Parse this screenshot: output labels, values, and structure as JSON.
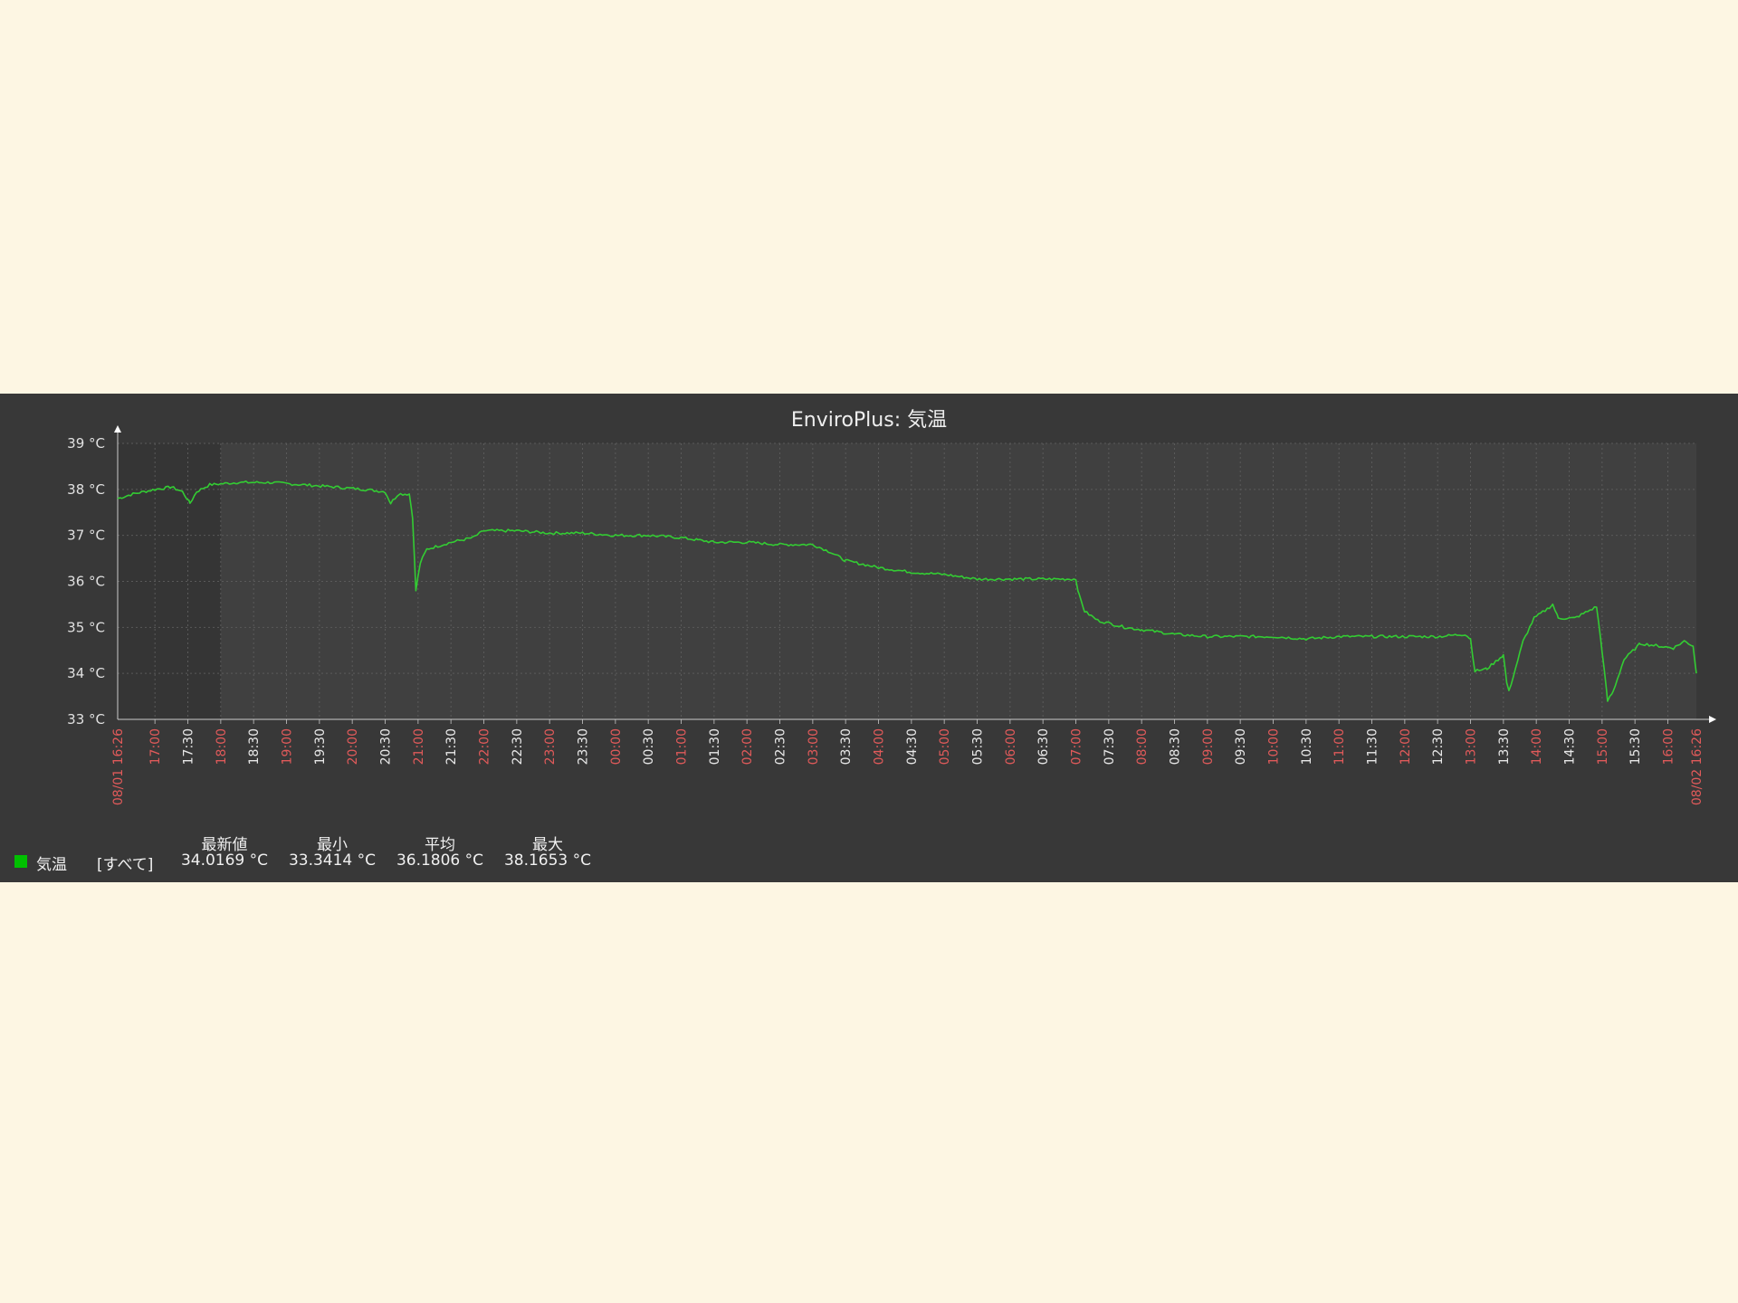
{
  "chart_data": {
    "type": "line",
    "title": "EnviroPlus: 気温",
    "y_ticks": [
      "33 °C",
      "34 °C",
      "35 °C",
      "36 °C",
      "37 °C",
      "38 °C",
      "39 °C"
    ],
    "ylim": [
      33,
      39
    ],
    "x_start_label": "08/01 16:26",
    "x_end_label": "08/02 16:26",
    "x_ticks": [
      "17:00",
      "17:30",
      "18:00",
      "18:30",
      "19:00",
      "19:30",
      "20:00",
      "20:30",
      "21:00",
      "21:30",
      "22:00",
      "22:30",
      "23:00",
      "23:30",
      "00:00",
      "00:30",
      "01:00",
      "01:30",
      "02:00",
      "02:30",
      "03:00",
      "03:30",
      "04:00",
      "04:30",
      "05:00",
      "05:30",
      "06:00",
      "06:30",
      "07:00",
      "07:30",
      "08:00",
      "08:30",
      "09:00",
      "09:30",
      "10:00",
      "10:30",
      "11:00",
      "11:30",
      "12:00",
      "12:30",
      "13:00",
      "13:30",
      "14:00",
      "14:30",
      "15:00",
      "15:30",
      "16:00"
    ],
    "x_range": [
      "08/01 16:26",
      "08/02 16:26"
    ],
    "grid": true,
    "colors": {
      "series": "#33cc33",
      "hour_tick": "#e05a5a",
      "half_tick": "#e8e8e8"
    },
    "series": [
      {
        "name": "気温",
        "color": "#00c000",
        "points": [
          [
            "08/01 16:26",
            37.8
          ],
          [
            "08/01 16:40",
            37.9
          ],
          [
            "08/01 17:00",
            38.0
          ],
          [
            "08/01 17:15",
            38.05
          ],
          [
            "08/01 17:25",
            37.95
          ],
          [
            "08/01 17:32",
            37.7
          ],
          [
            "08/01 17:38",
            37.95
          ],
          [
            "08/01 17:50",
            38.1
          ],
          [
            "08/01 18:15",
            38.15
          ],
          [
            "08/01 18:45",
            38.15
          ],
          [
            "08/01 19:15",
            38.1
          ],
          [
            "08/01 19:45",
            38.05
          ],
          [
            "08/01 20:10",
            38.0
          ],
          [
            "08/01 20:30",
            37.95
          ],
          [
            "08/01 20:35",
            37.7
          ],
          [
            "08/01 20:42",
            37.9
          ],
          [
            "08/01 20:52",
            37.9
          ],
          [
            "08/01 20:55",
            37.4
          ],
          [
            "08/01 20:58",
            35.8
          ],
          [
            "08/01 21:02",
            36.4
          ],
          [
            "08/01 21:08",
            36.7
          ],
          [
            "08/01 21:30",
            36.85
          ],
          [
            "08/01 21:50",
            36.95
          ],
          [
            "08/01 22:00",
            37.1
          ],
          [
            "08/01 22:30",
            37.1
          ],
          [
            "08/01 23:00",
            37.05
          ],
          [
            "08/01 23:30",
            37.05
          ],
          [
            "08/02 00:00",
            37.0
          ],
          [
            "08/02 00:30",
            37.0
          ],
          [
            "08/02 01:00",
            36.95
          ],
          [
            "08/02 01:15",
            36.9
          ],
          [
            "08/02 01:30",
            36.85
          ],
          [
            "08/02 02:00",
            36.85
          ],
          [
            "08/02 02:30",
            36.8
          ],
          [
            "08/02 03:00",
            36.8
          ],
          [
            "08/02 03:15",
            36.65
          ],
          [
            "08/02 03:30",
            36.45
          ],
          [
            "08/02 04:00",
            36.3
          ],
          [
            "08/02 04:30",
            36.2
          ],
          [
            "08/02 05:00",
            36.15
          ],
          [
            "08/02 05:30",
            36.05
          ],
          [
            "08/02 06:00",
            36.05
          ],
          [
            "08/02 06:30",
            36.05
          ],
          [
            "08/02 07:00",
            36.05
          ],
          [
            "08/02 07:03",
            35.7
          ],
          [
            "08/02 07:08",
            35.35
          ],
          [
            "08/02 07:20",
            35.15
          ],
          [
            "08/02 07:45",
            35.0
          ],
          [
            "08/02 08:00",
            34.95
          ],
          [
            "08/02 08:30",
            34.85
          ],
          [
            "08/02 09:00",
            34.8
          ],
          [
            "08/02 09:30",
            34.8
          ],
          [
            "08/02 10:00",
            34.8
          ],
          [
            "08/02 10:30",
            34.75
          ],
          [
            "08/02 11:00",
            34.8
          ],
          [
            "08/02 11:30",
            34.8
          ],
          [
            "08/02 12:00",
            34.8
          ],
          [
            "08/02 12:30",
            34.8
          ],
          [
            "08/02 12:55",
            34.85
          ],
          [
            "08/02 13:00",
            34.75
          ],
          [
            "08/02 13:04",
            34.05
          ],
          [
            "08/02 13:15",
            34.1
          ],
          [
            "08/02 13:30",
            34.4
          ],
          [
            "08/02 13:33",
            33.8
          ],
          [
            "08/02 13:35",
            33.6
          ],
          [
            "08/02 13:48",
            34.7
          ],
          [
            "08/02 13:58",
            35.2
          ],
          [
            "08/02 14:10",
            35.4
          ],
          [
            "08/02 14:15",
            35.5
          ],
          [
            "08/02 14:20",
            35.2
          ],
          [
            "08/02 14:35",
            35.2
          ],
          [
            "08/02 14:55",
            35.45
          ],
          [
            "08/02 15:00",
            34.5
          ],
          [
            "08/02 15:05",
            33.4
          ],
          [
            "08/02 15:10",
            33.6
          ],
          [
            "08/02 15:20",
            34.3
          ],
          [
            "08/02 15:35",
            34.65
          ],
          [
            "08/02 15:50",
            34.6
          ],
          [
            "08/02 16:05",
            34.55
          ],
          [
            "08/02 16:15",
            34.7
          ],
          [
            "08/02 16:23",
            34.6
          ],
          [
            "08/02 16:26",
            34.0
          ]
        ]
      }
    ]
  },
  "legend": {
    "series_name": "気温",
    "func": "[すべて]",
    "headers": {
      "last": "最新値",
      "min": "最小",
      "avg": "平均",
      "max": "最大"
    },
    "values": {
      "last": "34.0169 °C",
      "min": "33.3414 °C",
      "avg": "36.1806 °C",
      "max": "38.1653 °C"
    },
    "swatch_color": "#00c000"
  }
}
